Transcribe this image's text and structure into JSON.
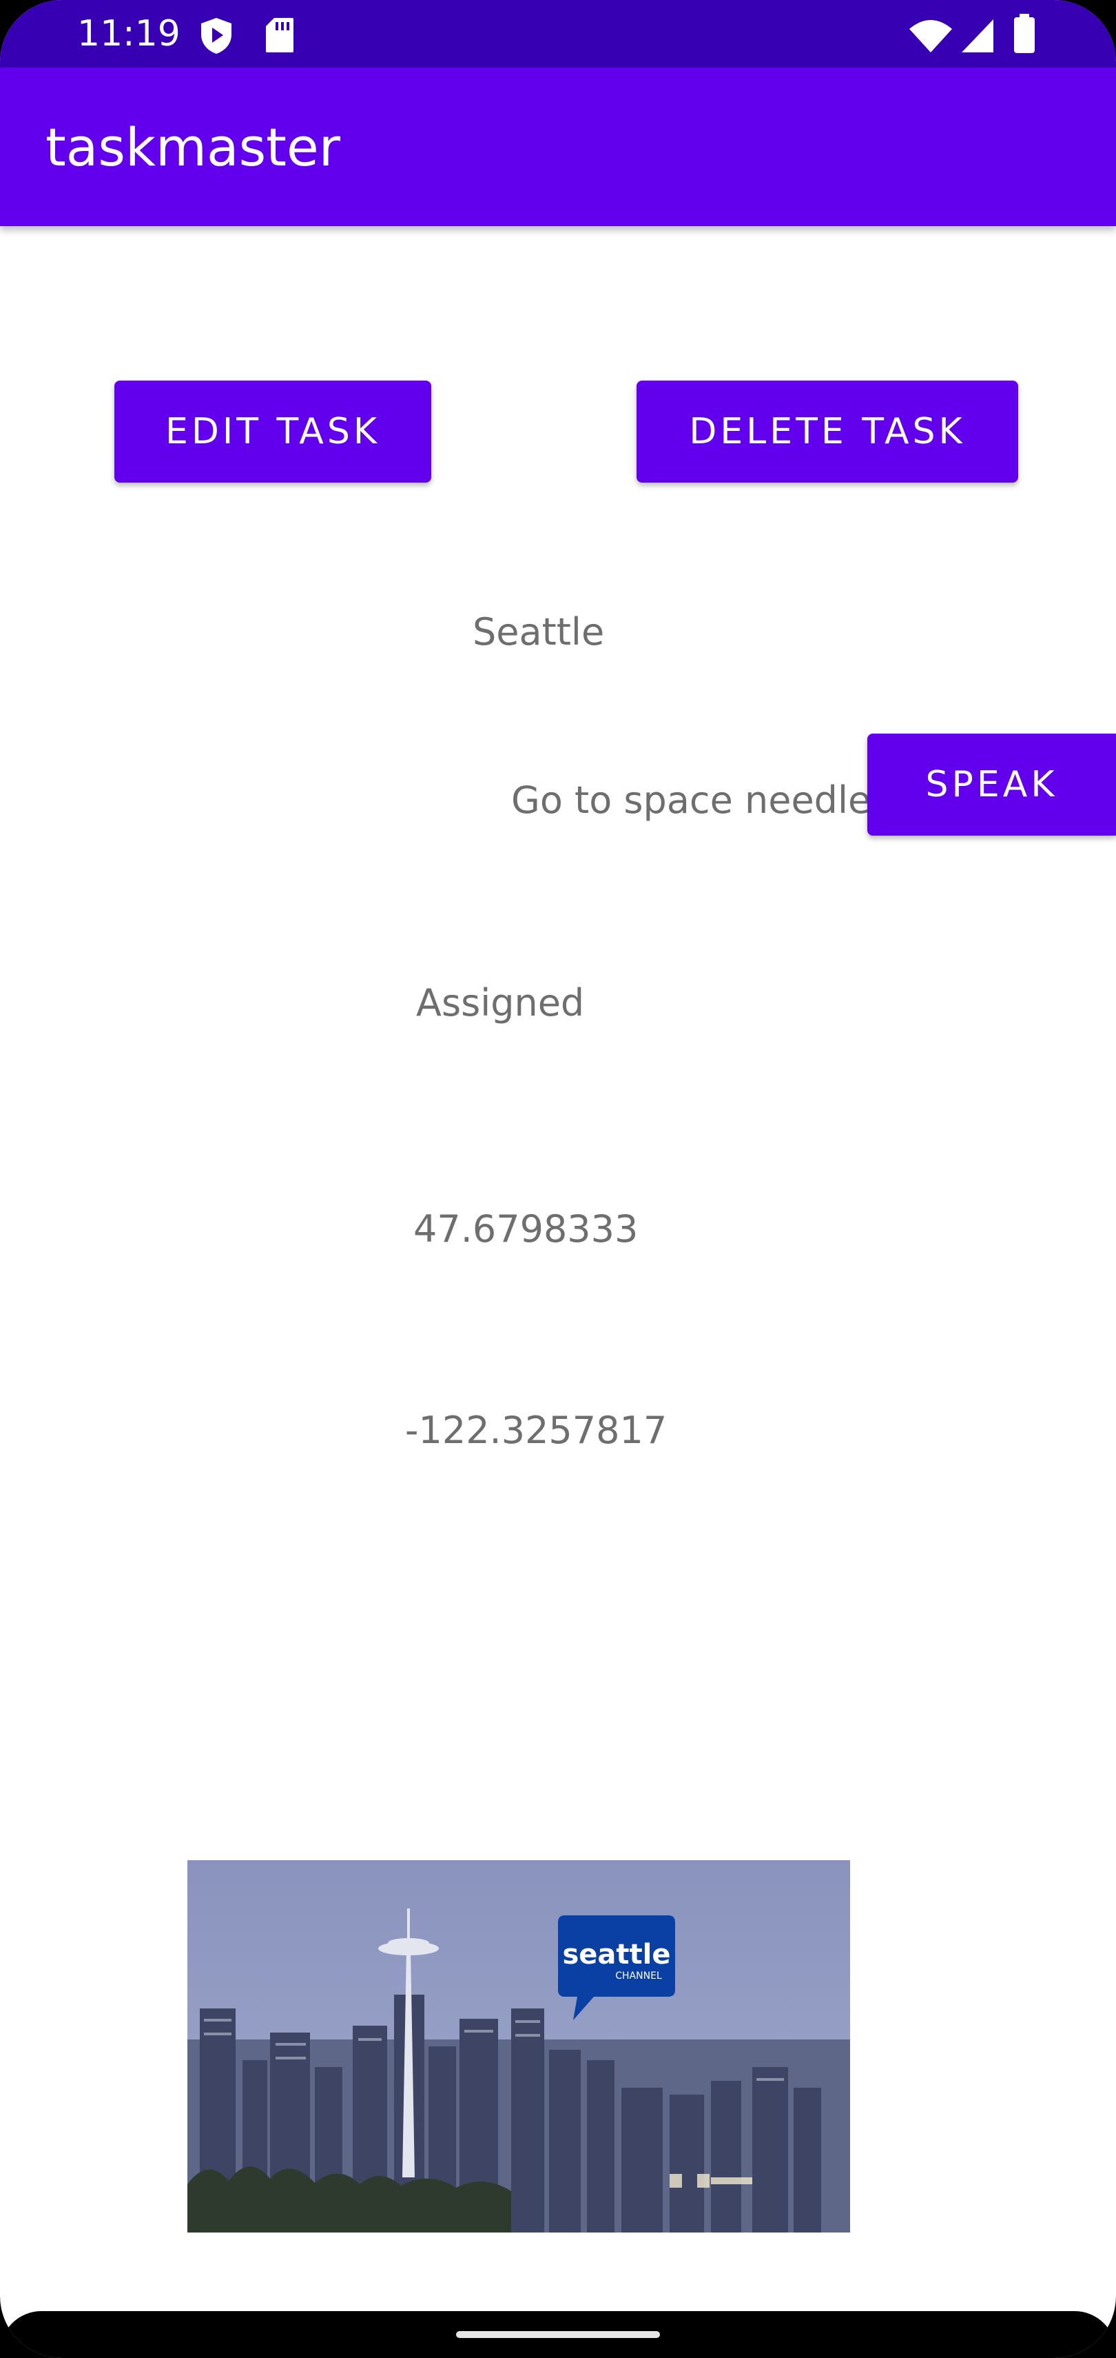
{
  "status_bar": {
    "time": "11:19",
    "color": "#3700B3",
    "left_icons": [
      "shield-play-icon",
      "sd-card-icon"
    ],
    "right_icons": [
      "wifi-icon",
      "cell-signal-icon",
      "battery-icon"
    ]
  },
  "app_bar": {
    "title": "taskmaster",
    "color": "#6200EE"
  },
  "actions": {
    "edit_label": "EDIT TASK",
    "delete_label": "DELETE TASK",
    "speak_label": "SPEAK"
  },
  "task": {
    "title": "Seattle",
    "description": "Go to space needle",
    "status": "Assigned",
    "latitude": "47.6798333",
    "longitude": "-122.3257817",
    "image": {
      "logo_text": "seattle",
      "logo_subtext": "CHANNEL"
    }
  },
  "colors": {
    "primary": "#6200EE",
    "primary_dark": "#3700B3",
    "text_secondary": "#6e6e6e"
  }
}
